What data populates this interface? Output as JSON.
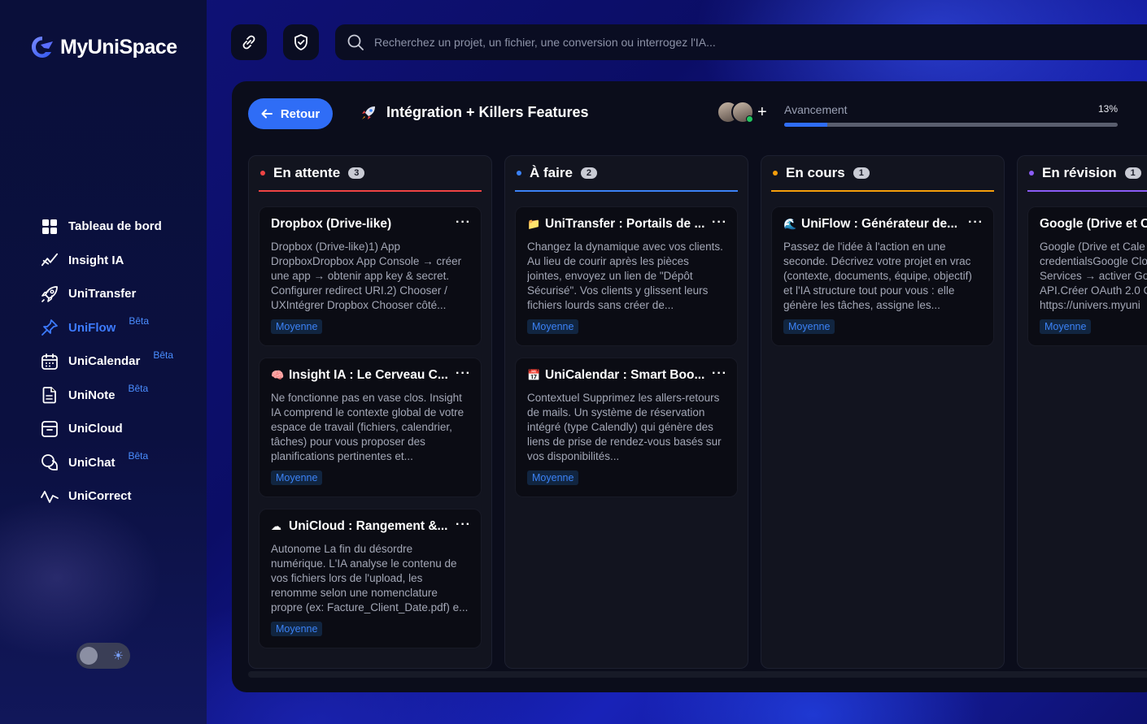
{
  "app": {
    "name": "MyUniSpace"
  },
  "sidebar": {
    "items": [
      {
        "label": "Tableau de bord",
        "icon": "dashboard-icon",
        "beta": ""
      },
      {
        "label": "Insight IA",
        "icon": "insight-icon",
        "beta": ""
      },
      {
        "label": "UniTransfer",
        "icon": "rocket-icon",
        "beta": ""
      },
      {
        "label": "UniFlow",
        "icon": "pin-icon",
        "beta": "Bêta",
        "active": true
      },
      {
        "label": "UniCalendar",
        "icon": "calendar-icon",
        "beta": "Bêta"
      },
      {
        "label": "UniNote",
        "icon": "note-icon",
        "beta": "Bêta"
      },
      {
        "label": "UniCloud",
        "icon": "cloud-box-icon",
        "beta": ""
      },
      {
        "label": "UniChat",
        "icon": "chat-icon",
        "beta": "Bêta"
      },
      {
        "label": "UniCorrect",
        "icon": "pulse-icon",
        "beta": ""
      }
    ]
  },
  "topbar": {
    "search_placeholder": "Recherchez un projet, un fichier, une conversion ou interrogez l'IA..."
  },
  "project": {
    "back_label": "Retour",
    "title": "Intégration + Killers Features",
    "progress_label": "Avancement",
    "progress_value": "13%",
    "progress_fraction": 0.13
  },
  "columns": [
    {
      "name": "En attente",
      "count": "3",
      "color": "#ef4444",
      "cards": [
        {
          "icon": "",
          "title": "Dropbox (Drive-like)",
          "desc": "Dropbox (Drive-like)1) App DropboxDropbox App Console → créer une app → obtenir app key & secret. Configurer redirect URI.2) Chooser / UXIntégrer Dropbox Chooser côté...",
          "tag": "Moyenne"
        },
        {
          "icon": "brain-icon",
          "title": "Insight IA : Le Cerveau C...",
          "desc": "Ne fonctionne pas en vase clos. Insight IA comprend le contexte global de votre espace de travail (fichiers, calendrier, tâches) pour vous proposer des planifications pertinentes et...",
          "tag": "Moyenne"
        },
        {
          "icon": "cloud-icon",
          "title": "UniCloud : Rangement &...",
          "desc": "Autonome La fin du désordre numérique. L'IA analyse le contenu de vos fichiers lors de l'upload, les renomme selon une nomenclature propre (ex: Facture_Client_Date.pdf) e...",
          "tag": "Moyenne"
        }
      ]
    },
    {
      "name": "À faire",
      "count": "2",
      "color": "#3b82f6",
      "cards": [
        {
          "icon": "folder-icon",
          "title": "UniTransfer : Portails de ...",
          "desc": "Changez la dynamique avec vos clients. Au lieu de courir après les pièces jointes, envoyez un lien de \"Dépôt Sécurisé\". Vos clients y glissent leurs fichiers lourds sans créer de...",
          "tag": "Moyenne"
        },
        {
          "icon": "calendar-icon",
          "title": "UniCalendar : Smart Boo...",
          "desc": "Contextuel Supprimez les allers-retours de mails. Un système de réservation intégré (type Calendly) qui génère des liens de prise de rendez-vous basés sur vos disponibilités...",
          "tag": "Moyenne"
        }
      ]
    },
    {
      "name": "En cours",
      "count": "1",
      "color": "#f59e0b",
      "cards": [
        {
          "icon": "wave-icon",
          "title": "UniFlow : Générateur de...",
          "desc": "Passez de l'idée à l'action en une seconde. Décrivez votre projet en vrac (contexte, documents, équipe, objectif) et l'IA structure tout pour vous : elle génère les tâches, assigne les...",
          "tag": "Moyenne"
        }
      ]
    },
    {
      "name": "En révision",
      "count": "1",
      "color": "#8b5cf6",
      "cards": [
        {
          "icon": "",
          "title": "Google (Drive et C",
          "desc": "Google (Drive et Cale credentialsGoogle Clo Services → activer Go API.Créer OAuth 2.0 C https://univers.myuni",
          "tag": "Moyenne"
        }
      ]
    }
  ]
}
